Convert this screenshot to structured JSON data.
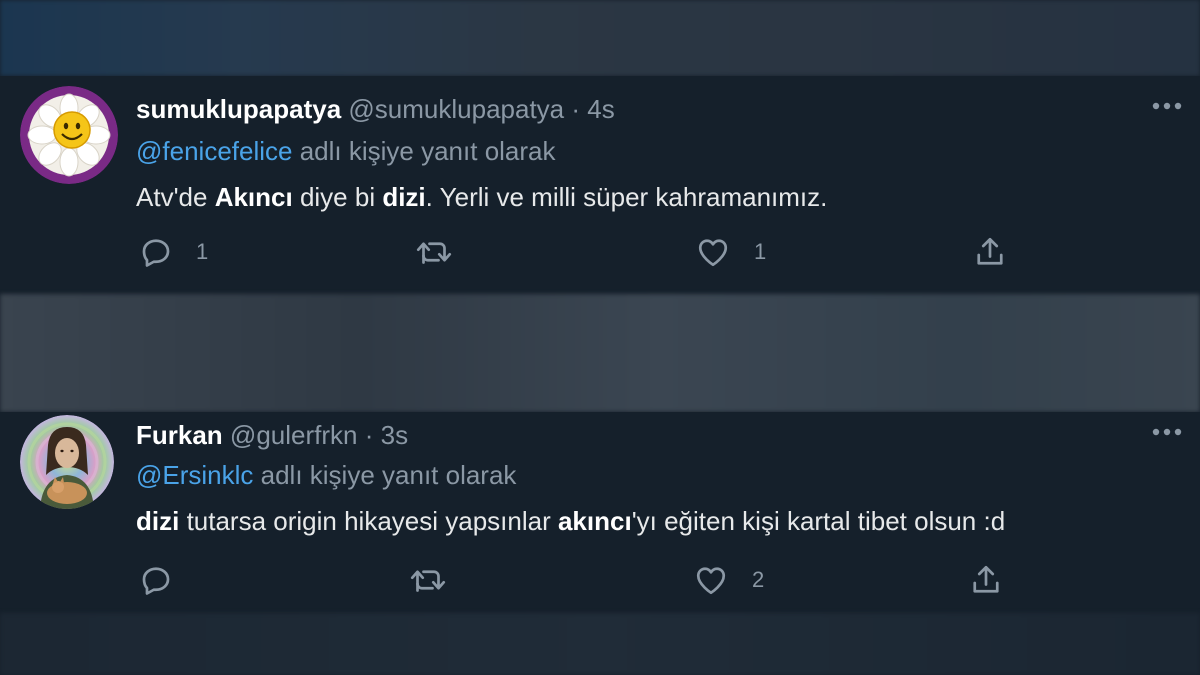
{
  "tweets": [
    {
      "name": "sumuklupapatya",
      "handle": "@sumuklupapatya",
      "separator": "·",
      "time": "4s",
      "reply_mention": "@fenicefelice",
      "reply_suffix": "adlı kişiye yanıt olarak",
      "body": [
        {
          "text": "Atv'de ",
          "bold": false
        },
        {
          "text": "Akıncı",
          "bold": true
        },
        {
          "text": " diye bi ",
          "bold": false
        },
        {
          "text": "dizi",
          "bold": true
        },
        {
          "text": ". Yerli ve milli süper kahramanımız.",
          "bold": false
        }
      ],
      "reply_count": "1",
      "retweet_count": "",
      "like_count": "1",
      "avatar_icon": "daisy-smiley-avatar"
    },
    {
      "name": "Furkan",
      "handle": "@gulerfrkn",
      "separator": "·",
      "time": "3s",
      "reply_mention": "@Ersinklc",
      "reply_suffix": "adlı kişiye yanıt olarak",
      "body": [
        {
          "text": "dizi",
          "bold": true
        },
        {
          "text": " tutarsa origin hikayesi yapsınlar ",
          "bold": false
        },
        {
          "text": "akıncı",
          "bold": true
        },
        {
          "text": "'yı eğiten kişi kartal tibet olsun :d",
          "bold": false
        }
      ],
      "reply_count": "",
      "retweet_count": "",
      "like_count": "2",
      "avatar_icon": "person-with-cat-avatar"
    }
  ],
  "icons": {
    "reply": "reply-icon",
    "retweet": "retweet-icon",
    "like": "heart-icon",
    "share": "share-icon",
    "more": "more-options-icon"
  },
  "colors": {
    "background": "#15202b",
    "mention": "#4aa3e8",
    "secondary_text": "#8b98a5"
  }
}
